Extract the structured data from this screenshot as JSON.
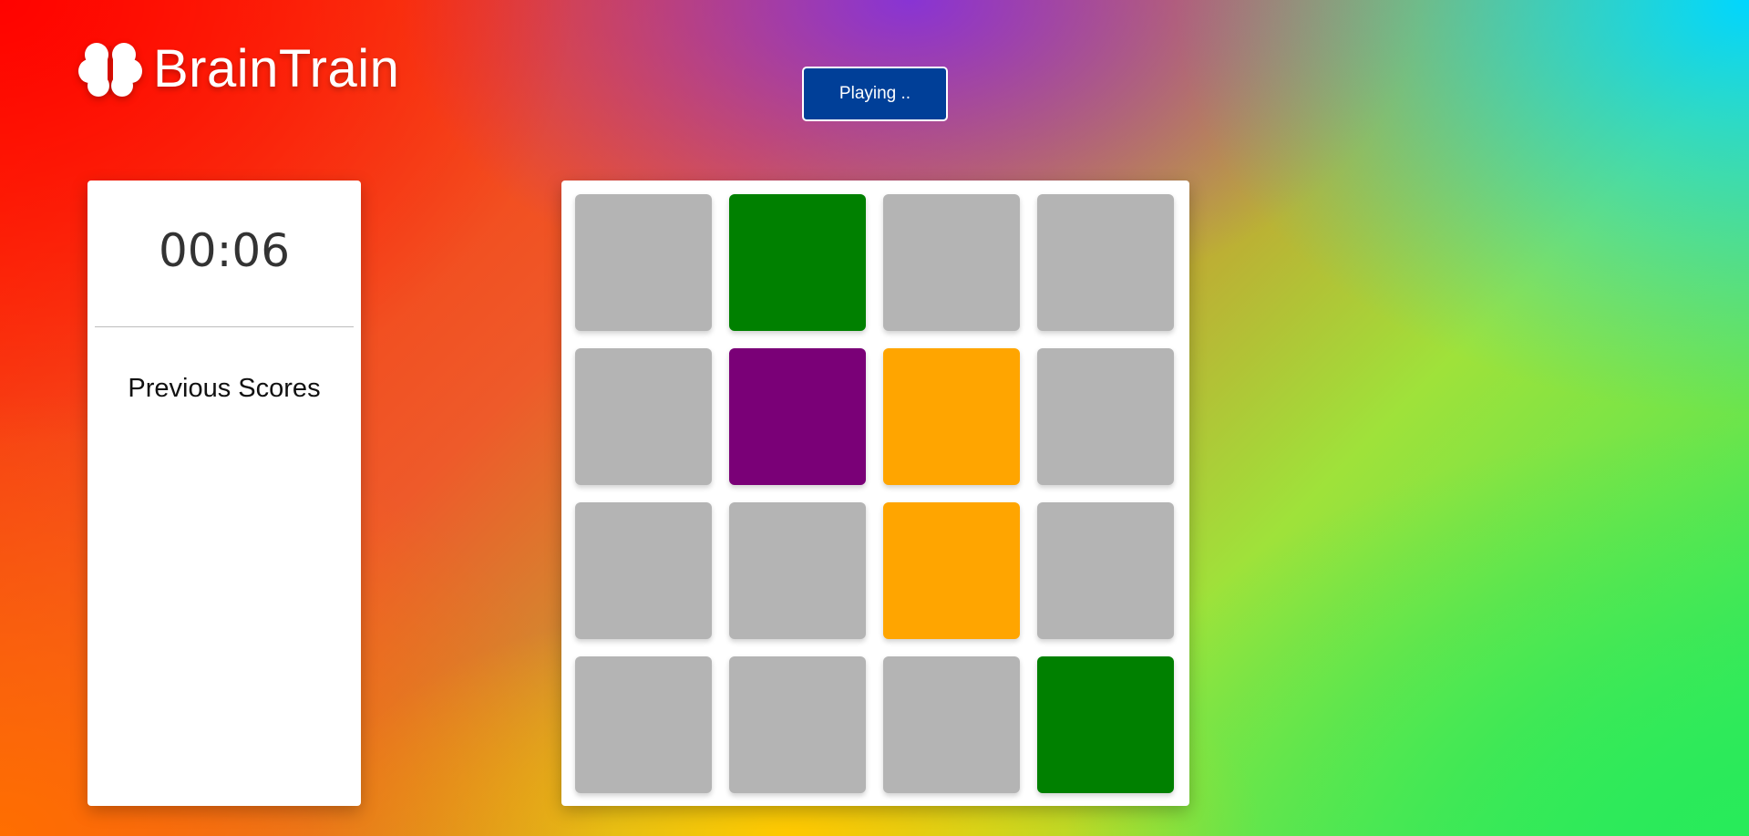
{
  "app": {
    "name": "BrainTrain",
    "logo_icon": "brain-icon"
  },
  "status_button": {
    "label": "Playing .."
  },
  "sidebar": {
    "timer": "00:06",
    "scores_title": "Previous Scores"
  },
  "board": {
    "rows": 4,
    "cols": 4,
    "tiles": [
      "gray",
      "green",
      "gray",
      "gray",
      "gray",
      "purple",
      "orange",
      "gray",
      "gray",
      "gray",
      "orange",
      "gray",
      "gray",
      "gray",
      "gray",
      "green"
    ]
  },
  "colors": {
    "gray": "#b4b4b4",
    "green": "#008000",
    "purple": "#7a0077",
    "orange": "#ffa500",
    "button": "#003f98"
  }
}
